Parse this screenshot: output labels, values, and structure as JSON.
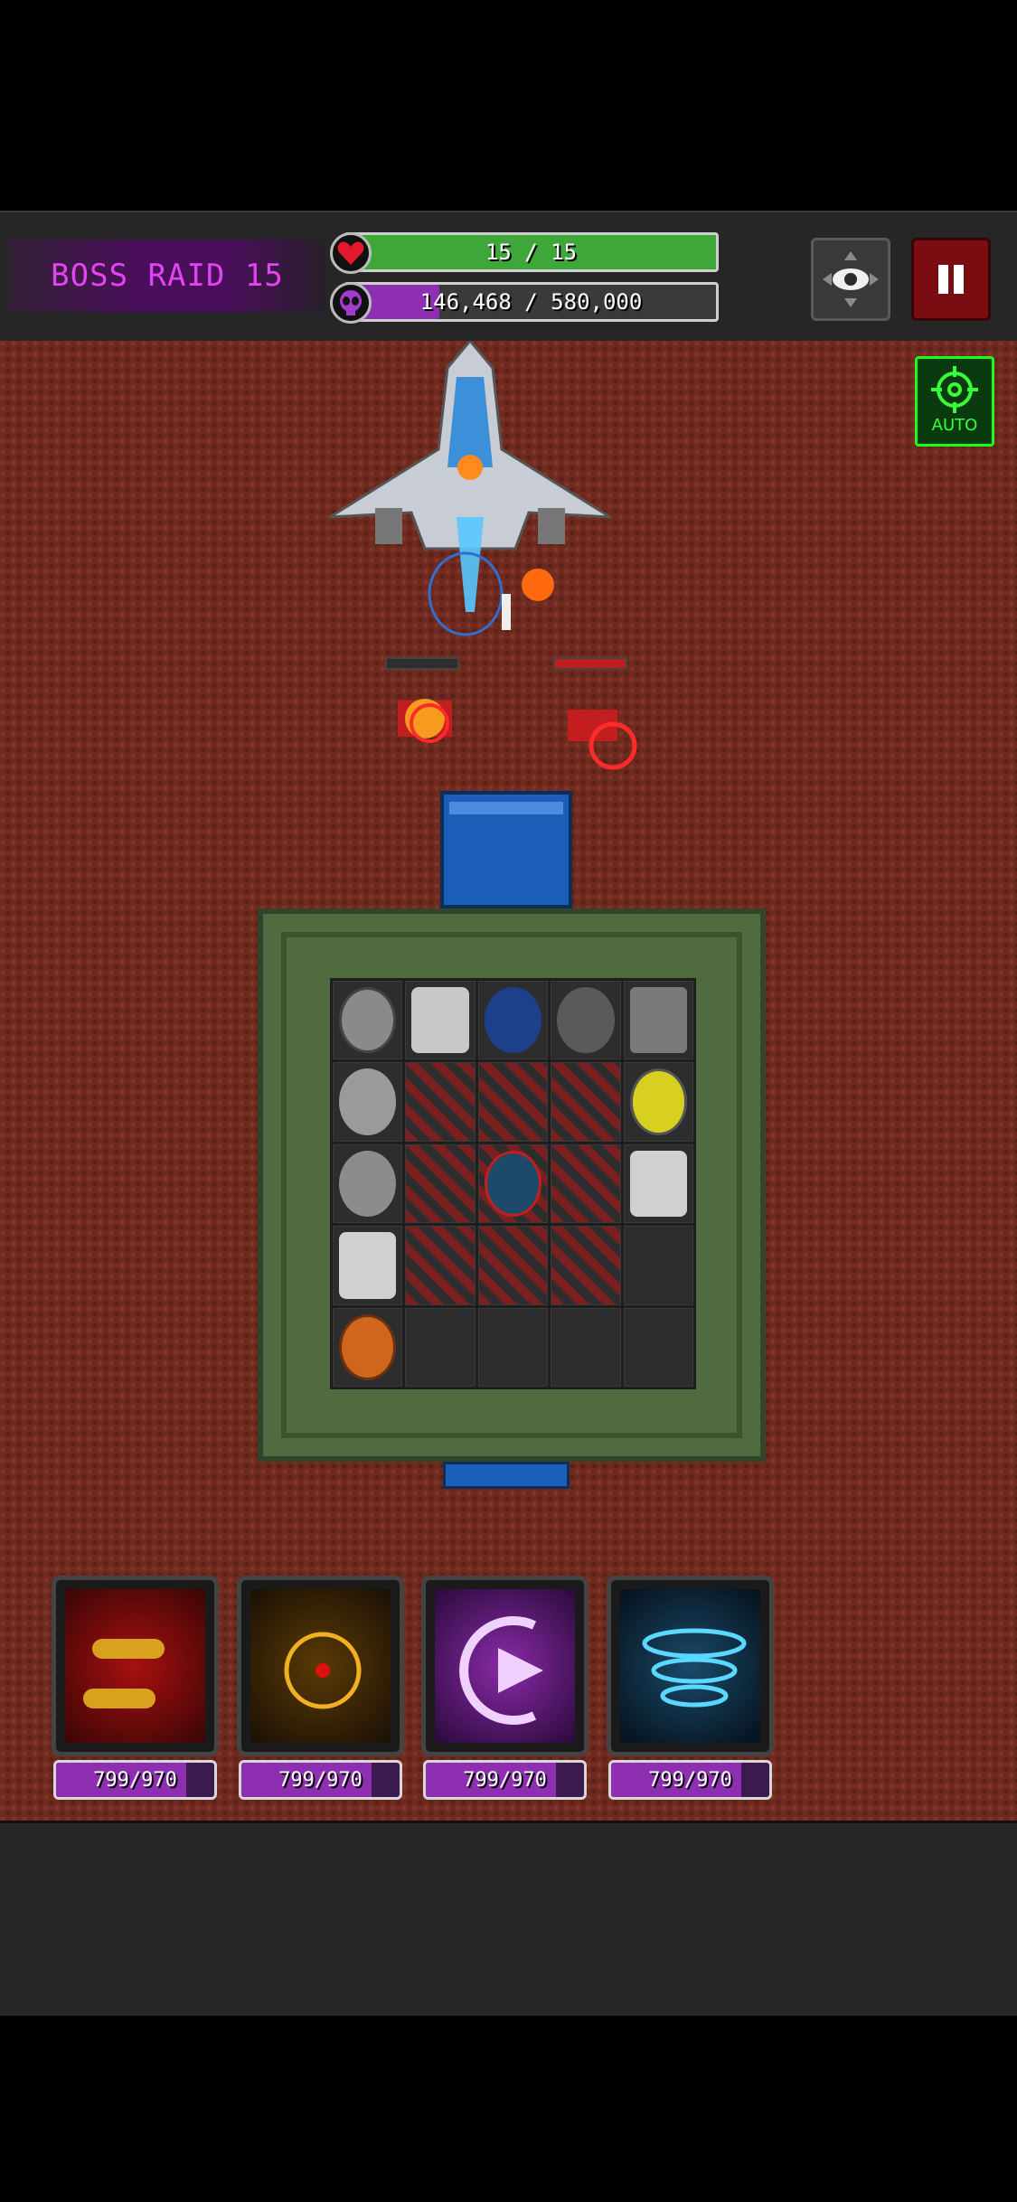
{
  "hud": {
    "raid_label": "BOSS RAID 15",
    "hp_text": "15 / 15",
    "hp_fraction": 1.0,
    "boss_text": "146,468 / 580,000",
    "boss_fraction": 0.2525,
    "hp_icon": "heart-icon",
    "boss_icon": "alien-skull-icon",
    "view_button_icon": "eye-icon",
    "pause_button_icon": "pause-icon"
  },
  "auto_button": {
    "label": "AUTO",
    "icon": "crosshair-icon"
  },
  "skills": [
    {
      "name": "bullet-skill",
      "charge_text": "799/970",
      "charge_fraction": 0.8237
    },
    {
      "name": "target-skill",
      "charge_text": "799/970",
      "charge_fraction": 0.8237
    },
    {
      "name": "dash-skill",
      "charge_text": "799/970",
      "charge_fraction": 0.8237
    },
    {
      "name": "tornado-skill",
      "charge_text": "799/970",
      "charge_fraction": 0.8237
    }
  ],
  "colors": {
    "hp_fill": "#3fa63a",
    "boss_fill": "#8e2fb2",
    "pause_bg": "#7a0d12",
    "auto_green": "#1aff1a"
  }
}
